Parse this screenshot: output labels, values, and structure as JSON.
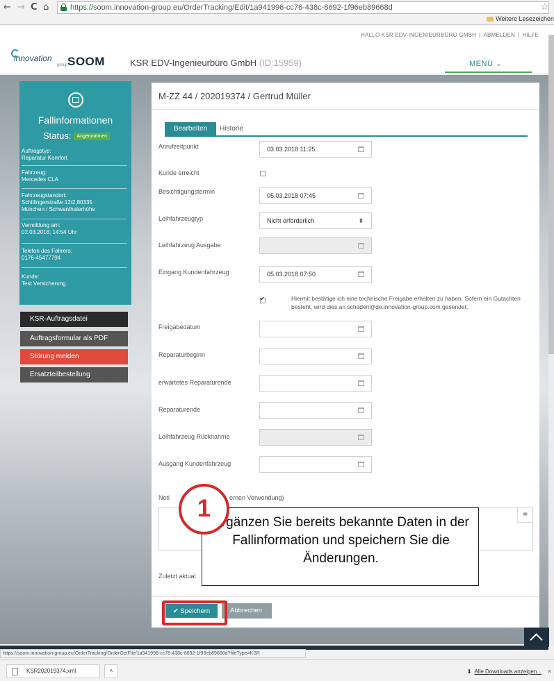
{
  "browser": {
    "back": "←",
    "forward": "→",
    "reload": "C",
    "home": "⌂",
    "url_scheme": "https://",
    "url_rest": "soom.innovation-group.eu/OrderTracking/Edit/1a941996-cc76-438c-8692-1f96eb89668d",
    "bookmark_folder": "Weitere Lesezeichen"
  },
  "header": {
    "user_greeting": "HALLO KSR EDV-INGENIEURBÜRO GMBH",
    "logout": "ABMELDEN",
    "help": "HILFE",
    "logo_text": "innovation",
    "logo_sub": "group",
    "app_name": "SOOM",
    "company": "KSR EDV-Ingenieurbüro GmbH",
    "company_id": "(ID:15959)",
    "menu": "MENÜ ⌄"
  },
  "sidebar": {
    "title": "Fallinformationen",
    "status_label": "Status:",
    "status_value": "Angenommen",
    "blocks": [
      {
        "label": "Auftragstyp:",
        "value": "Reparatur Komfort"
      },
      {
        "label": "Fahrzeug:",
        "value": "Mercedes CLA"
      },
      {
        "label": "Fahrzeugstandort:",
        "value": "Schillingerstraße 12/2,80335",
        "value2": "München / Schwanthalerhöhe"
      },
      {
        "label": "Vermittlung am:",
        "value": "02.03.2018, 14:54 Uhr"
      },
      {
        "label": "Telefon des Fahrers:",
        "value": "0176-45477794"
      },
      {
        "label": "Kunde:",
        "value": "Test Versicherung"
      }
    ],
    "buttons": [
      "KSR-Auftragsdatei",
      "Auftragsformular als PDF",
      "Störung melden",
      "Ersatzteilbestellung"
    ],
    "colors": {
      "panel": "#2e9aa3",
      "dark": "#2a2a2a",
      "alert": "#e04a3a",
      "gray": "#555555"
    }
  },
  "form": {
    "title": "M-ZZ 44 / 202019374 / Gertrud Müller",
    "tabs": [
      "Bearbeiten",
      "Historie"
    ],
    "fields": {
      "anrufzeitpunkt": {
        "label": "Anrufzeitpunkt",
        "value": "03.03.2018 11:25"
      },
      "kunde_erreicht": {
        "label": "Kunde erreicht"
      },
      "besichtigung": {
        "label": "Besichtigungstermin",
        "value": "05.03.2018 07:45"
      },
      "leihtyp": {
        "label": "Leihfahrzeugtyp",
        "value": "Nicht erforderlich"
      },
      "leih_ausgabe": {
        "label": "Leihfahrzeug Ausgabe",
        "value": ""
      },
      "eingang": {
        "label": "Eingang Kundenfahrzeug",
        "value": "05.03.2018 07:50"
      },
      "freigabe_text": "Hiermit bestätige ich eine technische Freigabe erhalten zu haben. Sofern ein Gutachten besteht, wird dies an schaden@de.innovation-group.com gesendet.",
      "freigabedatum": {
        "label": "Freigabedatum",
        "value": ""
      },
      "reparaturbeginn": {
        "label": "Reparaturbeginn",
        "value": ""
      },
      "erw_ende": {
        "label": "erwartetes Reparaturende",
        "value": ""
      },
      "reparaturende": {
        "label": "Reparaturende",
        "value": ""
      },
      "leih_ruecknahme": {
        "label": "Leihfahrzeug Rücknahme",
        "value": ""
      },
      "ausgang": {
        "label": "Ausgang Kundenfahrzeug",
        "value": ""
      },
      "notiz_label_start": "Noti",
      "notiz_label_end": "ernen Verwendung)",
      "zuletzt": "Zuletzt aktual"
    },
    "save": "✔ Speichern",
    "cancel": "Abbrechen"
  },
  "callout": {
    "number": "1",
    "text": "Ergänzen Sie bereits bekannte Daten in der Fallinformation und speichern Sie die Änderungen."
  },
  "status": {
    "url": "https://soom.innovation-group.eu/OrderTracking/OrderGetFile/1a941996-cc76-438c-8692-1f96eb89668d?fileType=KSR"
  },
  "downloads": {
    "file": "KSR202019374.xml",
    "show_all": "Alle Downloads anzeigen...",
    "close": "×"
  }
}
